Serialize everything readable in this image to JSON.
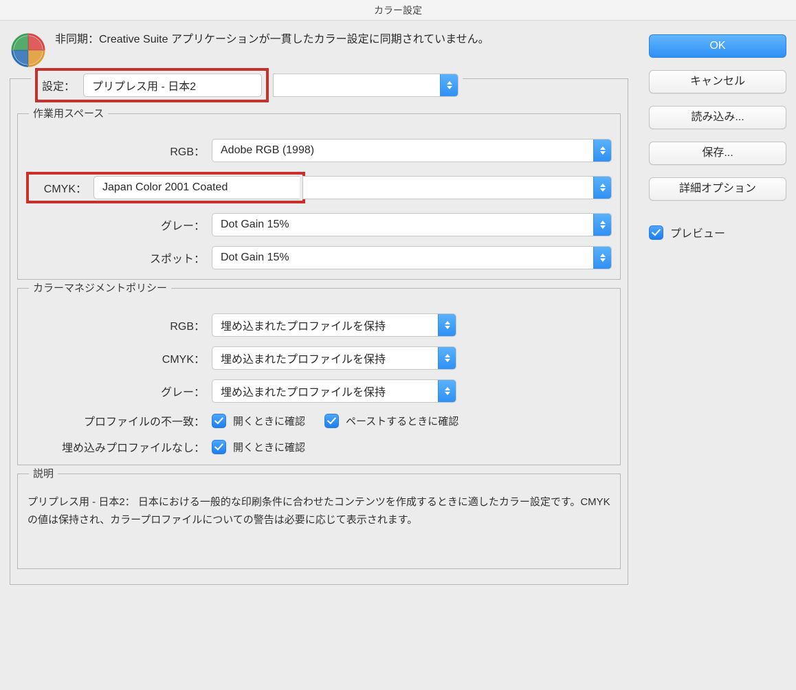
{
  "title": "カラー設定",
  "sync_message": "非同期：Creative Suite アプリケーションが一貫したカラー設定に同期されていません。",
  "settings": {
    "label": "設定：",
    "value": "プリプレス用 - 日本2"
  },
  "working_spaces": {
    "legend": "作業用スペース",
    "rgb_label": "RGB：",
    "rgb_value": "Adobe RGB (1998)",
    "cmyk_label": "CMYK：",
    "cmyk_value": "Japan Color 2001 Coated",
    "gray_label": "グレー：",
    "gray_value": "Dot Gain 15%",
    "spot_label": "スポット：",
    "spot_value": "Dot Gain 15%"
  },
  "policies": {
    "legend": "カラーマネジメントポリシー",
    "rgb_label": "RGB：",
    "rgb_value": "埋め込まれたプロファイルを保持",
    "cmyk_label": "CMYK：",
    "cmyk_value": "埋め込まれたプロファイルを保持",
    "gray_label": "グレー：",
    "gray_value": "埋め込まれたプロファイルを保持",
    "mismatch_label": "プロファイルの不一致：",
    "mismatch_open": "開くときに確認",
    "mismatch_paste": "ペーストするときに確認",
    "missing_label": "埋め込みプロファイルなし：",
    "missing_open": "開くときに確認"
  },
  "description": {
    "legend": "説明",
    "text": "プリプレス用 - 日本2： 日本における一般的な印刷条件に合わせたコンテンツを作成するときに適したカラー設定です。CMYK の値は保持され、カラープロファイルについての警告は必要に応じて表示されます。"
  },
  "buttons": {
    "ok": "OK",
    "cancel": "キャンセル",
    "load": "読み込み...",
    "save": "保存...",
    "advanced": "詳細オプション",
    "preview": "プレビュー"
  }
}
